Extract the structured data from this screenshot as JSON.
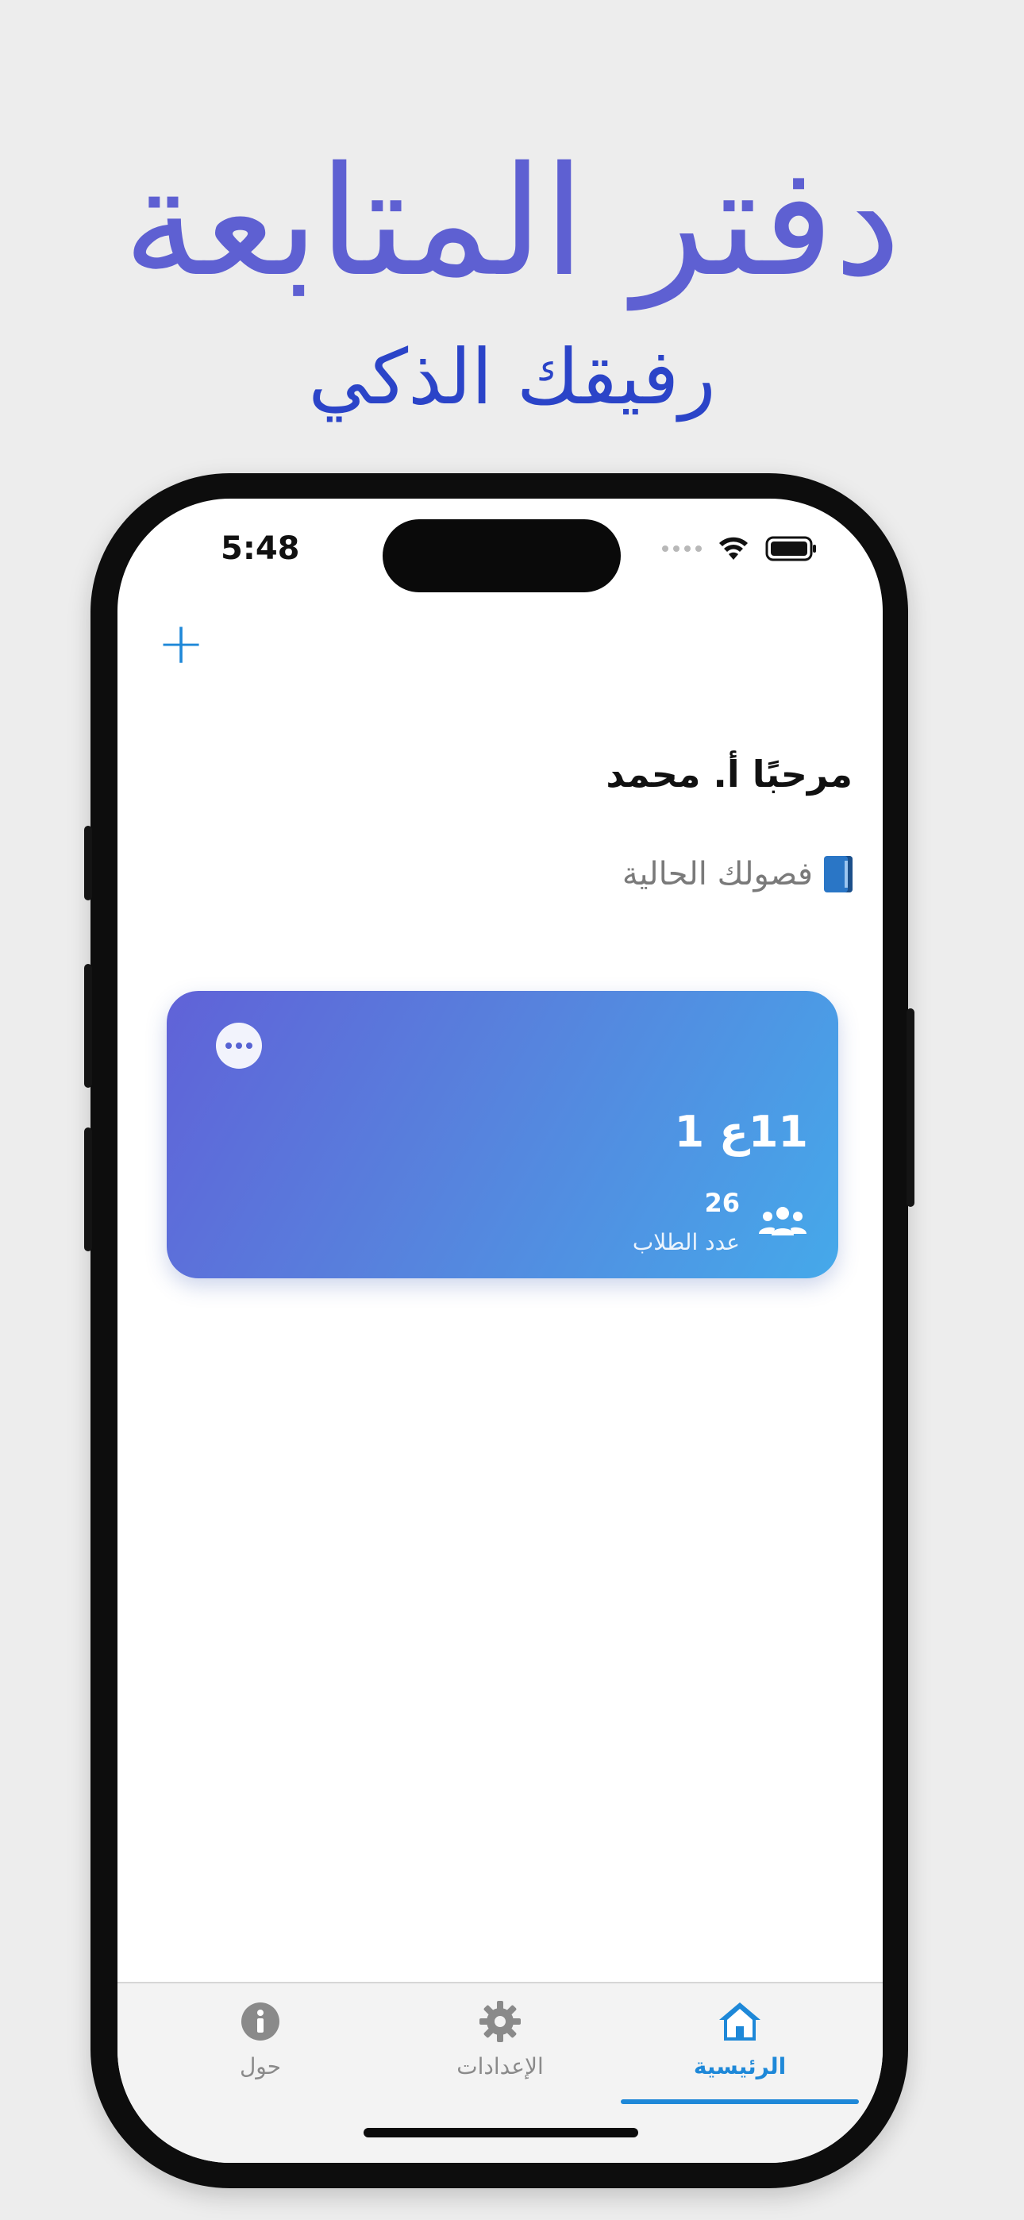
{
  "promo": {
    "title": "دفتر المتابعة",
    "subtitle": "رفيقك الذكي"
  },
  "status_bar": {
    "time": "5:48"
  },
  "header": {
    "add_button_label": "+"
  },
  "main": {
    "greeting": "مرحبًا أ. محمد",
    "classes_heading": "فصولك الحالية",
    "classes_heading_icon": "book-icon"
  },
  "class_cards": [
    {
      "title": "11ع 1",
      "student_count": "26",
      "student_count_label": "عدد الطلاب",
      "icon": "users-icon",
      "more_icon": "more-icon"
    }
  ],
  "tab_bar": {
    "tabs": [
      {
        "label": "الرئيسية",
        "icon": "home-icon",
        "active": true
      },
      {
        "label": "الإعدادات",
        "icon": "gear-icon",
        "active": false
      },
      {
        "label": "حول",
        "icon": "info-icon",
        "active": false
      }
    ]
  },
  "colors": {
    "accent": "#1e88d8",
    "promo_title": "#5e60d2",
    "promo_subtitle": "#2b44c8",
    "card_gradient_start": "#6062d8",
    "card_gradient_end": "#45a9ea"
  }
}
